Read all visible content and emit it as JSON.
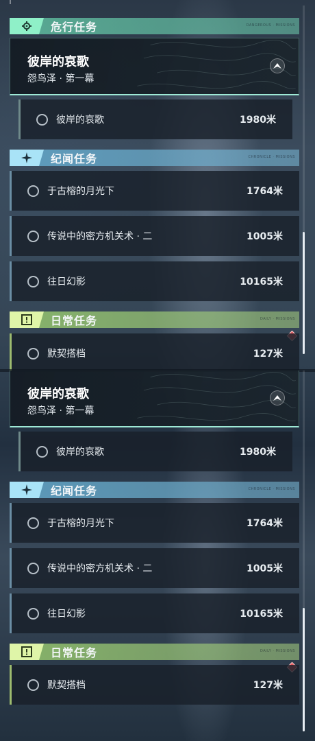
{
  "top": {
    "danger_category": {
      "title": "危行任务",
      "tag": "DANGEROUS · MISSIONS"
    },
    "featured": {
      "title": "彼岸的哀歌",
      "subtitle": "怨鸟泽 · 第一幕"
    },
    "sub_step": {
      "name": "彼岸的哀歌",
      "distance": "1980米"
    },
    "lore_category": {
      "title": "纪闻任务",
      "tag": "CHRONICLE · MISSIONS"
    },
    "lore_items": [
      {
        "name": "于古榕的月光下",
        "distance": "1764米"
      },
      {
        "name": "传说中的密方机关术 · 二",
        "distance": "1005米"
      },
      {
        "name": "往日幻影",
        "distance": "10165米"
      }
    ],
    "daily_category": {
      "title": "日常任务",
      "tag": "DAILY · MISSIONS"
    },
    "daily_items": [
      {
        "name": "默契搭档",
        "distance": "127米"
      }
    ]
  },
  "bottom": {
    "featured": {
      "title": "彼岸的哀歌",
      "subtitle": "怨鸟泽 · 第一幕"
    },
    "sub_step": {
      "name": "彼岸的哀歌",
      "distance": "1980米"
    },
    "lore_category": {
      "title": "纪闻任务",
      "tag": "CHRONICLE · MISSIONS"
    },
    "lore_items": [
      {
        "name": "于古榕的月光下",
        "distance": "1764米"
      },
      {
        "name": "传说中的密方机关术 · 二",
        "distance": "1005米"
      },
      {
        "name": "往日幻影",
        "distance": "10165米"
      }
    ],
    "daily_category": {
      "title": "日常任务",
      "tag": "DAILY · MISSIONS"
    },
    "daily_items": [
      {
        "name": "默契搭档",
        "distance": "127米"
      }
    ]
  },
  "icons": {
    "danger": "gear-target-icon",
    "lore": "sparkle-icon",
    "daily": "exclamation-box-icon",
    "track": "mountain-arrow-icon",
    "marker": "red-diamond-marker-icon"
  },
  "colors": {
    "danger_accent": "#8ff0c8",
    "lore_accent": "#a9e3f7",
    "daily_accent": "#dff5a8",
    "marker": "#e25a5f"
  }
}
